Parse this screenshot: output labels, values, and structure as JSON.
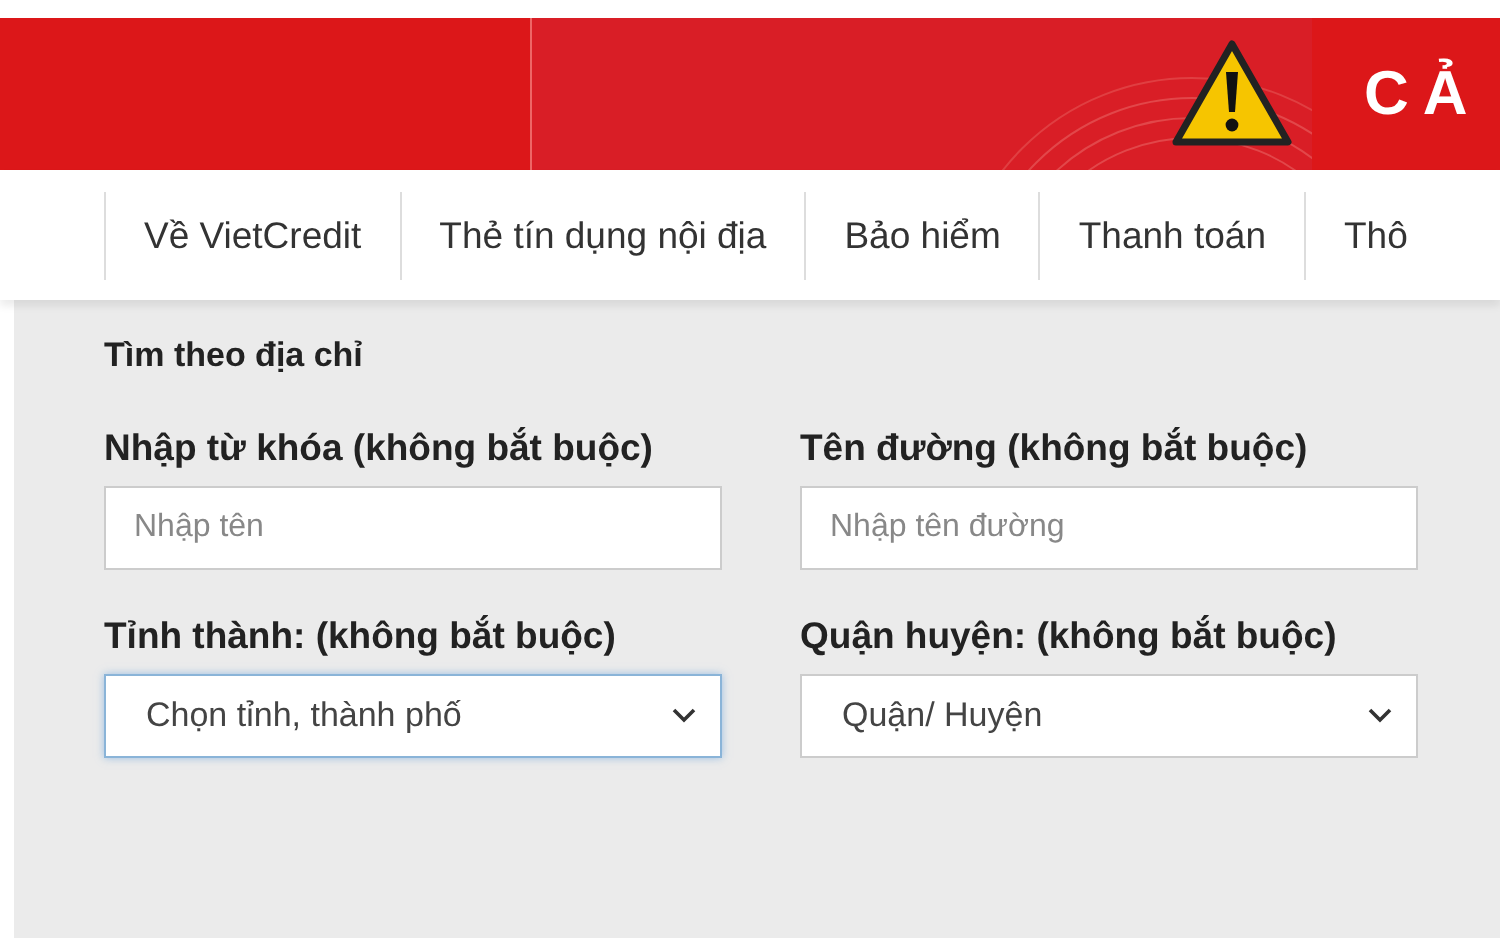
{
  "banner": {
    "title": "CẢ"
  },
  "nav": [
    {
      "label": "Về VietCredit"
    },
    {
      "label": "Thẻ tín dụng nội địa"
    },
    {
      "label": "Bảo hiểm"
    },
    {
      "label": "Thanh toán"
    },
    {
      "label": "Thô"
    }
  ],
  "search": {
    "title": "Tìm theo địa chỉ",
    "fields": [
      {
        "kind": "input",
        "label": "Nhập từ khóa (không bắt buộc)",
        "placeholder": "Nhập tên",
        "focused": false
      },
      {
        "kind": "input",
        "label": "Tên đường (không bắt buộc)",
        "placeholder": "Nhập tên đường",
        "focused": false
      },
      {
        "kind": "select",
        "label": "Tỉnh thành: (không bắt buộc)",
        "value": "Chọn tỉnh, thành phố",
        "focused": true
      },
      {
        "kind": "select",
        "label": "Quận huyện: (không bắt buộc)",
        "value": "Quận/ Huyện",
        "focused": false
      }
    ]
  }
}
